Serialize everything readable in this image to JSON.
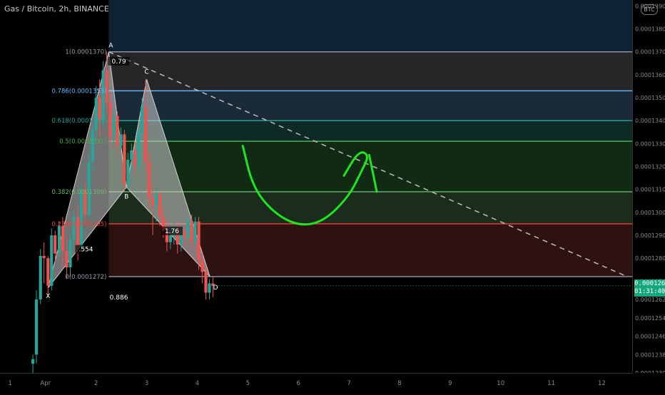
{
  "header": {
    "symbol_title": "Gas / Bitcoin, 2h, BINANCE",
    "currency_badge": "BTC"
  },
  "price_tag": {
    "price": "0.0001268",
    "countdown": "01:31:40"
  },
  "colors": {
    "background": "#000000",
    "up_candle": "#26a69a",
    "down_candle": "#ef5350",
    "harmonic_fill": "#d0d0d0",
    "curve": "#1ee61e",
    "fib_1": "#9a9aa6",
    "fib_0786": "#64b5f6",
    "fib_0618": "#26a69a",
    "fib_05": "#4caf50",
    "fib_0382": "#66bb6a",
    "fib_0236": "#f44336",
    "fib_0": "#9a9aa6"
  },
  "chart_data": {
    "type": "candlestick",
    "x_axis": {
      "tick_labels": [
        "1",
        "Apr",
        "2",
        "3",
        "4",
        "5",
        "6",
        "7",
        "8",
        "9",
        "10",
        "11",
        "12"
      ],
      "tick_values": [
        0.3,
        1,
        2,
        3,
        4,
        5,
        6,
        7,
        8,
        9,
        10,
        11,
        12
      ],
      "range": [
        0.1,
        12.6
      ]
    },
    "y_axis": {
      "tick_labels": [
        "0.0001390",
        "0.0001380",
        "0.0001370",
        "0.0001360",
        "0.0001350",
        "0.0001340",
        "0.0001330",
        "0.0001320",
        "0.0001310",
        "0.0001300",
        "0.0001290",
        "0.0001280",
        "0.0001270",
        "0.0001262",
        "0.0001254",
        "0.0001246",
        "0.0001238",
        "0.0001230"
      ],
      "tick_values": [
        0.000139,
        0.000138,
        0.000137,
        0.000136,
        0.000135,
        0.000134,
        0.000133,
        0.000132,
        0.000131,
        0.00013,
        0.000129,
        0.000128,
        0.000127,
        0.0001262,
        0.0001254,
        0.0001246,
        0.0001238,
        0.000123
      ],
      "range": [
        0.000123,
        0.00013926
      ]
    },
    "current_price": 0.0001268,
    "fib_levels": [
      {
        "ratio": "1",
        "price": 0.000137,
        "label": "1(0.0001370)",
        "color": "#9a9aa6",
        "band": "#262629"
      },
      {
        "ratio": "0.786",
        "price": 0.0001353,
        "label": "0.786(0.0001353)",
        "color": "#64b5f6",
        "band": "#1a2a38"
      },
      {
        "ratio": "0.618",
        "price": 0.000134,
        "label": "0.618(0.0001340)",
        "color": "#26a69a",
        "band": "#0e2a26"
      },
      {
        "ratio": "0.5",
        "price": 0.0001331,
        "label": "0.5(0.0001331)",
        "color": "#4caf50",
        "band": "#102a14"
      },
      {
        "ratio": "0.382",
        "price": 0.0001309,
        "label": "0.382(0.0001309)",
        "color": "#66bb6a",
        "band": "#1c2c1c"
      },
      {
        "ratio": "0.236",
        "price": 0.0001295,
        "label": "0.236(0.0001295)",
        "color": "#f44336",
        "band": "#2e1212"
      },
      {
        "ratio": "0",
        "price": 0.0001272,
        "label": "0(0.0001272)",
        "color": "#9a9aa6",
        "band": ""
      }
    ],
    "fib_top_band": {
      "from_price": 0.000137,
      "to_price": 0.00013926,
      "color": "#0e2236"
    },
    "fib_x_range": [
      2.25,
      12.6
    ],
    "harmonic": {
      "points": [
        {
          "name": "X",
          "x": 1.05,
          "y": 0.0001267
        },
        {
          "name": "A",
          "x": 2.25,
          "y": 0.000137
        },
        {
          "name": "B",
          "x": 2.6,
          "y": 0.0001311
        },
        {
          "name": "C",
          "x": 3.0,
          "y": 0.0001358
        },
        {
          "name": "D",
          "x": 4.25,
          "y": 0.0001272
        }
      ],
      "ratio_labels": [
        {
          "text": "0.79",
          "x": 2.45,
          "y": 0.0001365
        },
        {
          "text": ".554",
          "x": 1.8,
          "y": 0.0001283
        },
        {
          "text": "1.76",
          "x": 3.5,
          "y": 0.0001291
        },
        {
          "text": "0.886",
          "x": 2.45,
          "y": 0.0001262
        }
      ]
    },
    "trend_line": {
      "x1": 2.25,
      "y1": 0.000137,
      "x2": 12.5,
      "y2": 0.0001272
    },
    "curve_points": [
      [
        4.9,
        0.0001329
      ],
      [
        5.1,
        0.0001311
      ],
      [
        5.5,
        0.00013
      ],
      [
        6.0,
        0.0001294
      ],
      [
        6.5,
        0.0001296
      ],
      [
        7.0,
        0.0001307
      ],
      [
        7.25,
        0.0001318
      ],
      [
        7.4,
        0.0001325
      ],
      [
        7.2,
        0.0001327
      ],
      [
        6.9,
        0.0001316
      ]
    ],
    "curve_hook": [
      [
        7.4,
        0.0001325
      ],
      [
        7.55,
        0.0001309
      ]
    ],
    "candles": [
      {
        "x": 0.75,
        "o": 0.0001234,
        "h": 0.0001238,
        "l": 0.000123,
        "c": 0.0001236
      },
      {
        "x": 0.82,
        "o": 0.0001238,
        "h": 0.0001266,
        "l": 0.0001234,
        "c": 0.0001262
      },
      {
        "x": 0.9,
        "o": 0.0001262,
        "h": 0.0001284,
        "l": 0.000126,
        "c": 0.0001281
      },
      {
        "x": 0.97,
        "o": 0.0001281,
        "h": 0.0001287,
        "l": 0.0001269,
        "c": 0.000128
      },
      {
        "x": 1.05,
        "o": 0.000128,
        "h": 0.0001281,
        "l": 0.0001263,
        "c": 0.0001268
      },
      {
        "x": 1.12,
        "o": 0.0001268,
        "h": 0.0001293,
        "l": 0.0001266,
        "c": 0.000129
      },
      {
        "x": 1.19,
        "o": 0.000129,
        "h": 0.0001292,
        "l": 0.0001278,
        "c": 0.0001282
      },
      {
        "x": 1.27,
        "o": 0.0001282,
        "h": 0.0001296,
        "l": 0.000128,
        "c": 0.0001294
      },
      {
        "x": 1.34,
        "o": 0.0001294,
        "h": 0.0001298,
        "l": 0.0001276,
        "c": 0.0001283
      },
      {
        "x": 1.42,
        "o": 0.0001283,
        "h": 0.0001289,
        "l": 0.0001271,
        "c": 0.0001276
      },
      {
        "x": 1.49,
        "o": 0.0001276,
        "h": 0.000129,
        "l": 0.0001272,
        "c": 0.0001288
      },
      {
        "x": 1.56,
        "o": 0.0001288,
        "h": 0.0001301,
        "l": 0.0001284,
        "c": 0.0001298
      },
      {
        "x": 1.64,
        "o": 0.0001298,
        "h": 0.0001303,
        "l": 0.0001279,
        "c": 0.0001285
      },
      {
        "x": 1.71,
        "o": 0.0001285,
        "h": 0.0001312,
        "l": 0.0001283,
        "c": 0.000131
      },
      {
        "x": 1.78,
        "o": 0.000131,
        "h": 0.0001313,
        "l": 0.0001296,
        "c": 0.0001299
      },
      {
        "x": 1.86,
        "o": 0.0001299,
        "h": 0.0001326,
        "l": 0.0001297,
        "c": 0.0001322
      },
      {
        "x": 1.93,
        "o": 0.0001322,
        "h": 0.0001339,
        "l": 0.0001318,
        "c": 0.0001336
      },
      {
        "x": 2.0,
        "o": 0.0001336,
        "h": 0.0001355,
        "l": 0.0001331,
        "c": 0.000135
      },
      {
        "x": 2.07,
        "o": 0.000135,
        "h": 0.0001358,
        "l": 0.0001333,
        "c": 0.000134
      },
      {
        "x": 2.14,
        "o": 0.000134,
        "h": 0.0001366,
        "l": 0.0001337,
        "c": 0.0001362
      },
      {
        "x": 2.21,
        "o": 0.0001362,
        "h": 0.000137,
        "l": 0.0001344,
        "c": 0.0001348
      },
      {
        "x": 2.28,
        "o": 0.0001348,
        "h": 0.0001352,
        "l": 0.0001328,
        "c": 0.0001333
      },
      {
        "x": 2.35,
        "o": 0.0001333,
        "h": 0.0001345,
        "l": 0.000133,
        "c": 0.0001342
      },
      {
        "x": 2.42,
        "o": 0.0001342,
        "h": 0.0001344,
        "l": 0.0001325,
        "c": 0.0001329
      },
      {
        "x": 2.49,
        "o": 0.0001329,
        "h": 0.0001337,
        "l": 0.0001327,
        "c": 0.0001334
      },
      {
        "x": 2.56,
        "o": 0.0001334,
        "h": 0.0001336,
        "l": 0.0001309,
        "c": 0.0001312
      },
      {
        "x": 2.63,
        "o": 0.0001312,
        "h": 0.0001326,
        "l": 0.000131,
        "c": 0.0001323
      },
      {
        "x": 2.7,
        "o": 0.0001323,
        "h": 0.000133,
        "l": 0.0001318,
        "c": 0.0001327
      },
      {
        "x": 2.77,
        "o": 0.0001327,
        "h": 0.000133,
        "l": 0.0001316,
        "c": 0.000132
      },
      {
        "x": 2.84,
        "o": 0.000132,
        "h": 0.0001337,
        "l": 0.0001318,
        "c": 0.0001335
      },
      {
        "x": 2.91,
        "o": 0.0001335,
        "h": 0.000135,
        "l": 0.0001332,
        "c": 0.0001346
      },
      {
        "x": 2.98,
        "o": 0.0001346,
        "h": 0.0001358,
        "l": 0.0001318,
        "c": 0.0001322
      },
      {
        "x": 3.05,
        "o": 0.0001322,
        "h": 0.0001326,
        "l": 0.0001302,
        "c": 0.0001306
      },
      {
        "x": 3.12,
        "o": 0.0001306,
        "h": 0.0001312,
        "l": 0.000129,
        "c": 0.0001303
      },
      {
        "x": 3.19,
        "o": 0.0001303,
        "h": 0.0001311,
        "l": 0.0001296,
        "c": 0.0001308
      },
      {
        "x": 3.26,
        "o": 0.0001308,
        "h": 0.0001309,
        "l": 0.0001294,
        "c": 0.0001298
      },
      {
        "x": 3.33,
        "o": 0.0001298,
        "h": 0.0001302,
        "l": 0.0001289,
        "c": 0.0001292
      },
      {
        "x": 3.4,
        "o": 0.0001292,
        "h": 0.0001296,
        "l": 0.0001283,
        "c": 0.0001287
      },
      {
        "x": 3.47,
        "o": 0.0001287,
        "h": 0.0001295,
        "l": 0.0001284,
        "c": 0.000129
      },
      {
        "x": 3.54,
        "o": 0.000129,
        "h": 0.0001296,
        "l": 0.0001286,
        "c": 0.0001293
      },
      {
        "x": 3.61,
        "o": 0.0001293,
        "h": 0.0001295,
        "l": 0.0001282,
        "c": 0.0001286
      },
      {
        "x": 3.68,
        "o": 0.0001286,
        "h": 0.0001294,
        "l": 0.0001283,
        "c": 0.0001292
      },
      {
        "x": 3.75,
        "o": 0.0001292,
        "h": 0.0001294,
        "l": 0.0001285,
        "c": 0.0001289
      },
      {
        "x": 3.82,
        "o": 0.0001289,
        "h": 0.0001298,
        "l": 0.0001287,
        "c": 0.0001296
      },
      {
        "x": 3.89,
        "o": 0.0001296,
        "h": 0.0001299,
        "l": 0.0001284,
        "c": 0.0001287
      },
      {
        "x": 3.96,
        "o": 0.0001287,
        "h": 0.0001298,
        "l": 0.0001285,
        "c": 0.0001296
      },
      {
        "x": 4.03,
        "o": 0.0001296,
        "h": 0.0001298,
        "l": 0.0001275,
        "c": 0.0001279
      },
      {
        "x": 4.1,
        "o": 0.0001279,
        "h": 0.0001282,
        "l": 0.0001269,
        "c": 0.0001274
      },
      {
        "x": 4.17,
        "o": 0.0001274,
        "h": 0.0001277,
        "l": 0.0001262,
        "c": 0.0001265
      },
      {
        "x": 4.24,
        "o": 0.0001265,
        "h": 0.0001271,
        "l": 0.0001262,
        "c": 0.0001269
      },
      {
        "x": 4.31,
        "o": 0.0001269,
        "h": 0.0001272,
        "l": 0.0001263,
        "c": 0.0001268
      }
    ]
  }
}
